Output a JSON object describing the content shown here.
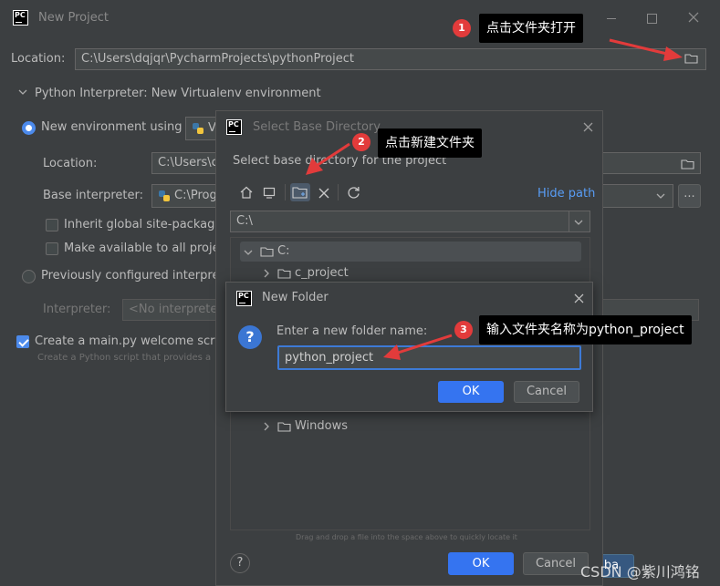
{
  "main_window": {
    "title": "New Project",
    "location_label": "Location:",
    "location_value": "C:\\Users\\dqjqr\\PycharmProjects\\pythonProject",
    "interpreter_section": "Python Interpreter: New Virtualenv environment",
    "new_env_label": "New environment using",
    "new_env_value": "V",
    "env_location_label": "Location:",
    "env_location_value": "C:\\Users\\c",
    "base_interp_label": "Base interpreter:",
    "base_interp_value": "C:\\Prog",
    "inherit_label": "Inherit global site-package",
    "available_label": "Make available to all projec",
    "previously_label": "Previously configured interpre",
    "interpreter_label": "Interpreter:",
    "interpreter_value": "<No interprete",
    "create_main_label": "Create a main.py welcome scrip",
    "create_main_hint": "Create a Python script that provides a",
    "more_label": "...",
    "ok_label": "ba"
  },
  "select_dialog": {
    "title": "Select Base Directory",
    "subtitle": "Select base directory for the project",
    "hide_path": "Hide path",
    "path_value": "C:\\",
    "tree": [
      {
        "label": "C:",
        "expanded": true
      },
      {
        "label": "c_project",
        "expanded": false
      },
      {
        "label": "Windows",
        "expanded": false
      }
    ],
    "drag_hint": "Drag and drop a file into the space above to quickly locate it",
    "help_label": "?",
    "ok_label": "OK",
    "cancel_label": "Cancel"
  },
  "new_folder_dialog": {
    "title": "New Folder",
    "prompt": "Enter a new folder name:",
    "input_value": "python_project",
    "ok_label": "OK",
    "cancel_label": "Cancel"
  },
  "annotations": [
    {
      "number": "1",
      "text": "点击文件夹打开"
    },
    {
      "number": "2",
      "text": "点击新建文件夹"
    },
    {
      "number": "3",
      "text": "输入文件夹名称为python_project"
    }
  ],
  "watermark": "CSDN @紫川鸿铭",
  "colors": {
    "accent": "#4c8aeb",
    "annotation_red": "#e23b3b",
    "link": "#589df6"
  }
}
